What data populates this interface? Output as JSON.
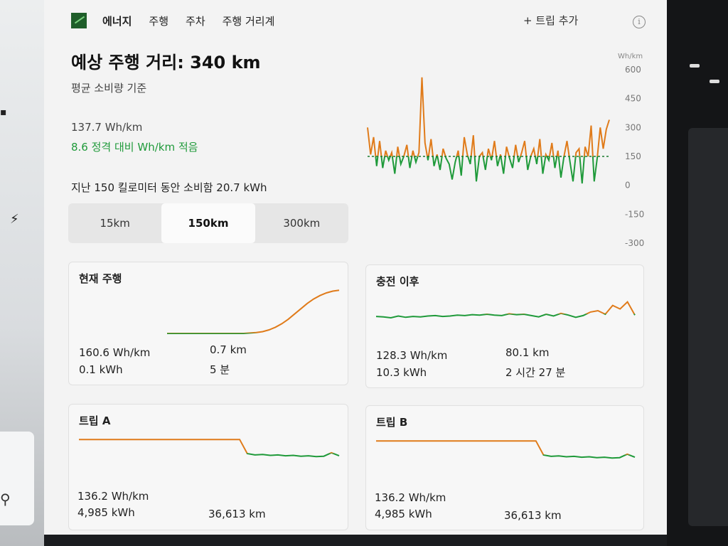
{
  "nav": {
    "logo_label": "에너지",
    "tabs": [
      "주행",
      "주차",
      "주행 거리계"
    ],
    "add_trip": "+ 트립 추가",
    "info": "i"
  },
  "summary": {
    "title": "예상 주행 거리: 340 km",
    "subtitle": "평균 소비량 기준",
    "efficiency": "137.7 Wh/km",
    "efficiency_delta": "8.6 정격 대비 Wh/km 적음",
    "last_distance": "지난 150 킬로미터 동안 소비함 20.7 kWh"
  },
  "range_selector": {
    "options": [
      "15km",
      "150km",
      "300km"
    ],
    "selected": "150km"
  },
  "colors": {
    "above": "#e07b1a",
    "below": "#1f9a3a",
    "accent_green": "#1f9a3a"
  },
  "chart_data": {
    "type": "line",
    "unit": "Wh/km",
    "ylim": [
      -300,
      600
    ],
    "yticks": [
      600,
      450,
      300,
      150,
      0,
      -150,
      -300
    ],
    "reference": 150,
    "values": [
      300,
      160,
      250,
      100,
      230,
      90,
      180,
      130,
      170,
      60,
      200,
      110,
      150,
      210,
      90,
      180,
      120,
      170,
      560,
      220,
      130,
      240,
      100,
      160,
      80,
      190,
      140,
      110,
      30,
      120,
      180,
      50,
      250,
      160,
      110,
      260,
      20,
      150,
      170,
      80,
      190,
      130,
      230,
      100,
      160,
      60,
      200,
      140,
      90,
      210,
      120,
      170,
      230,
      80,
      150,
      190,
      110,
      240,
      60,
      160,
      130,
      220,
      90,
      180,
      40,
      150,
      230,
      120,
      20,
      170,
      190,
      10,
      200,
      150,
      310,
      20,
      140,
      300,
      190,
      290,
      340
    ]
  },
  "cards": [
    {
      "title": "현재 주행",
      "energy_rate": "160.6 Wh/km",
      "energy": "0.1 kWh",
      "distance": "0.7 km",
      "duration": "5 분",
      "trend": [
        0.0,
        0.0,
        0.0,
        0.0,
        0.0,
        0.0,
        0.0,
        0.0,
        0.0,
        0.0,
        0.0,
        0.0,
        0.0,
        0.01,
        0.02,
        0.04,
        0.08,
        0.14,
        0.22,
        0.32,
        0.44,
        0.56,
        0.68,
        0.78,
        0.86,
        0.92,
        0.96,
        0.98
      ]
    },
    {
      "title": "충전 이후",
      "energy_rate": "128.3 Wh/km",
      "energy": "10.3 kWh",
      "distance": "80.1 km",
      "duration": "2 시간 27 분",
      "trend": [
        0.45,
        0.44,
        0.42,
        0.46,
        0.43,
        0.45,
        0.44,
        0.46,
        0.47,
        0.45,
        0.46,
        0.48,
        0.47,
        0.49,
        0.48,
        0.5,
        0.48,
        0.47,
        0.51,
        0.49,
        0.5,
        0.47,
        0.44,
        0.5,
        0.46,
        0.52,
        0.48,
        0.43,
        0.47,
        0.55,
        0.58,
        0.5,
        0.7,
        0.62,
        0.78,
        0.48
      ]
    },
    {
      "title": "트립 A",
      "energy_rate": "136.2 Wh/km",
      "energy": "4,985 kWh",
      "distance": "36,613 km",
      "trend": [
        0.82,
        0.82,
        0.82,
        0.82,
        0.82,
        0.82,
        0.82,
        0.82,
        0.82,
        0.82,
        0.82,
        0.82,
        0.82,
        0.82,
        0.82,
        0.82,
        0.82,
        0.82,
        0.82,
        0.82,
        0.82,
        0.82,
        0.5,
        0.47,
        0.48,
        0.46,
        0.47,
        0.45,
        0.46,
        0.44,
        0.45,
        0.43,
        0.44,
        0.52,
        0.45
      ]
    },
    {
      "title": "트립 B",
      "energy_rate": "136.2 Wh/km",
      "energy": "4,985 kWh",
      "distance": "36,613 km",
      "trend": [
        0.82,
        0.82,
        0.82,
        0.82,
        0.82,
        0.82,
        0.82,
        0.82,
        0.82,
        0.82,
        0.82,
        0.82,
        0.82,
        0.82,
        0.82,
        0.82,
        0.82,
        0.82,
        0.82,
        0.82,
        0.82,
        0.82,
        0.5,
        0.47,
        0.48,
        0.46,
        0.47,
        0.45,
        0.46,
        0.44,
        0.45,
        0.43,
        0.44,
        0.52,
        0.45
      ]
    }
  ]
}
